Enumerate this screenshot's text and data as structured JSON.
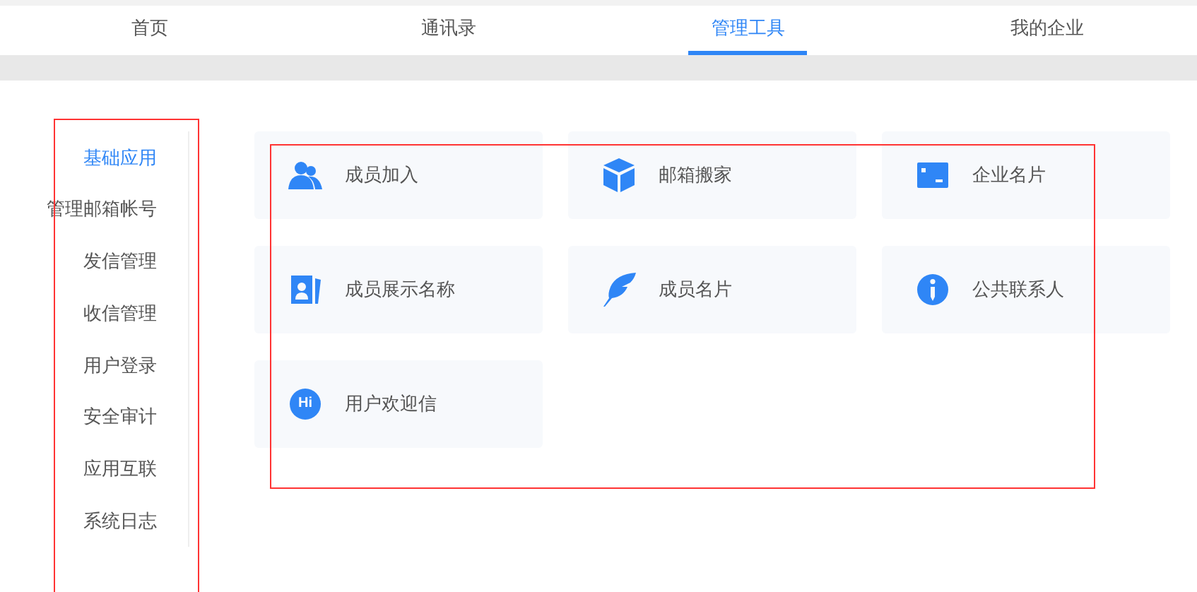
{
  "top_nav": [
    {
      "label": "首页",
      "selected": false
    },
    {
      "label": "通讯录",
      "selected": false
    },
    {
      "label": "管理工具",
      "selected": true
    },
    {
      "label": "我的企业",
      "selected": false
    }
  ],
  "sidebar": {
    "items": [
      {
        "label": "基础应用",
        "selected": true
      },
      {
        "label": "管理邮箱帐号",
        "selected": false
      },
      {
        "label": "发信管理",
        "selected": false
      },
      {
        "label": "收信管理",
        "selected": false
      },
      {
        "label": "用户登录",
        "selected": false
      },
      {
        "label": "安全审计",
        "selected": false
      },
      {
        "label": "应用互联",
        "selected": false
      },
      {
        "label": "系统日志",
        "selected": false
      }
    ]
  },
  "tools": [
    {
      "label": "成员加入",
      "kind": "people"
    },
    {
      "label": "邮箱搬家",
      "kind": "box"
    },
    {
      "label": "企业名片",
      "kind": "card"
    },
    {
      "label": "成员展示名称",
      "kind": "contact"
    },
    {
      "label": "成员名片",
      "kind": "feather"
    },
    {
      "label": "公共联系人",
      "kind": "info"
    },
    {
      "label": "用户欢迎信",
      "kind": "hi",
      "icon_text": "Hi"
    }
  ]
}
